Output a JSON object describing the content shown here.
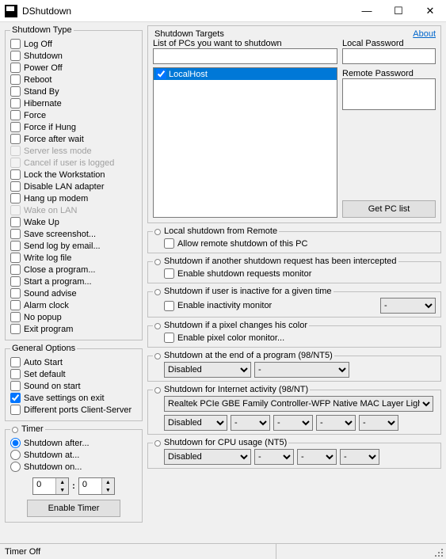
{
  "window": {
    "title": "DShutdown",
    "min": "—",
    "max": "☐",
    "close": "✕"
  },
  "about": "About",
  "shutdown_type": {
    "legend": "Shutdown Type",
    "items": [
      {
        "id": "logoff",
        "label": "Log Off",
        "chk": false,
        "en": true
      },
      {
        "id": "shutdown",
        "label": "Shutdown",
        "chk": false,
        "en": true
      },
      {
        "id": "poweroff",
        "label": "Power Off",
        "chk": false,
        "en": true
      },
      {
        "id": "reboot",
        "label": "Reboot",
        "chk": false,
        "en": true
      },
      {
        "id": "standby",
        "label": "Stand By",
        "chk": false,
        "en": true
      },
      {
        "id": "hibernate",
        "label": "Hibernate",
        "chk": false,
        "en": true
      },
      {
        "id": "force",
        "label": "Force",
        "chk": false,
        "en": true
      },
      {
        "id": "forcehung",
        "label": "Force if Hung",
        "chk": false,
        "en": true
      },
      {
        "id": "forcewait",
        "label": "Force after wait",
        "chk": false,
        "en": true
      },
      {
        "id": "serverless",
        "label": "Server less mode",
        "chk": false,
        "en": false
      },
      {
        "id": "cancellogged",
        "label": "Cancel if user is logged",
        "chk": false,
        "en": false
      },
      {
        "id": "lockws",
        "label": "Lock the Workstation",
        "chk": false,
        "en": true
      },
      {
        "id": "dislan",
        "label": "Disable LAN adapter",
        "chk": false,
        "en": true
      },
      {
        "id": "hangup",
        "label": "Hang up modem",
        "chk": false,
        "en": true
      },
      {
        "id": "wol",
        "label": "Wake on LAN",
        "chk": false,
        "en": false
      },
      {
        "id": "wakeup",
        "label": "Wake Up",
        "chk": false,
        "en": true
      },
      {
        "id": "savess",
        "label": "Save screenshot...",
        "chk": false,
        "en": true
      },
      {
        "id": "sendlog",
        "label": "Send log by email...",
        "chk": false,
        "en": true
      },
      {
        "id": "writelog",
        "label": "Write log file",
        "chk": false,
        "en": true
      },
      {
        "id": "closep",
        "label": "Close a program...",
        "chk": false,
        "en": true
      },
      {
        "id": "startp",
        "label": "Start a program...",
        "chk": false,
        "en": true
      },
      {
        "id": "sound",
        "label": "Sound advise",
        "chk": false,
        "en": true
      },
      {
        "id": "alarm",
        "label": "Alarm clock",
        "chk": false,
        "en": true
      },
      {
        "id": "nopopup",
        "label": "No popup",
        "chk": false,
        "en": true
      },
      {
        "id": "exit",
        "label": "Exit program",
        "chk": false,
        "en": true
      }
    ]
  },
  "general": {
    "legend": "General Options",
    "items": [
      {
        "id": "autostart",
        "label": "Auto Start",
        "chk": false
      },
      {
        "id": "setdef",
        "label": "Set default",
        "chk": false
      },
      {
        "id": "soundstart",
        "label": "Sound on start",
        "chk": false
      },
      {
        "id": "savesettings",
        "label": "Save settings on exit",
        "chk": true
      },
      {
        "id": "diffports",
        "label": "Different ports Client-Server",
        "chk": false
      }
    ]
  },
  "timer": {
    "legend": "Timer",
    "opts": [
      {
        "id": "after",
        "label": "Shutdown after...",
        "sel": true
      },
      {
        "id": "at",
        "label": "Shutdown at...",
        "sel": false
      },
      {
        "id": "on",
        "label": "Shutdown on...",
        "sel": false
      }
    ],
    "h": "0",
    "m": "0",
    "sep": ":",
    "enable": "Enable Timer"
  },
  "targets": {
    "legend": "Shutdown Targets",
    "list_label": "List of PCs you want to shutdown",
    "local_pw": "Local Password",
    "remote_pw": "Remote Password",
    "hosts": [
      {
        "name": "LocalHost",
        "chk": true
      }
    ],
    "getpc": "Get PC list"
  },
  "sections": {
    "lsr": {
      "head": "Local shutdown from Remote",
      "chk": "Allow remote shutdown of this PC"
    },
    "intercept": {
      "head": "Shutdown if another shutdown request has been intercepted",
      "chk": "Enable shutdown requests monitor"
    },
    "inactive": {
      "head": "Shutdown if user is inactive for a given time",
      "chk": "Enable inactivity monitor"
    },
    "pixel": {
      "head": "Shutdown if a pixel changes his color",
      "chk": "Enable pixel color monitor..."
    },
    "endprog": {
      "head": "Shutdown at the end of a program (98/NT5)"
    },
    "internet": {
      "head": "Shutdown for Internet activity (98/NT)"
    },
    "cpu": {
      "head": "Shutdown for CPU usage (NT5)"
    }
  },
  "selects": {
    "disabled": "Disabled",
    "dash": "-",
    "nic": "Realtek PCIe GBE Family Controller-WFP Native MAC Layer Light\\"
  },
  "status": {
    "text": "Timer Off"
  }
}
